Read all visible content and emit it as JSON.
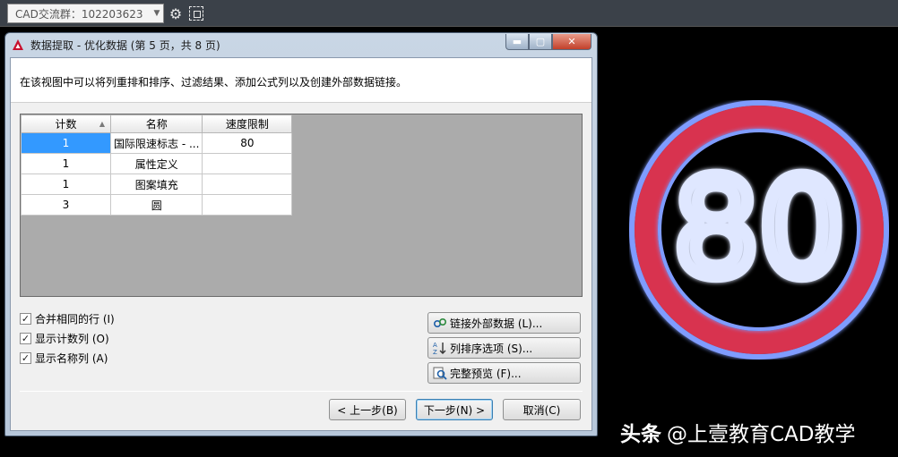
{
  "toolbar": {
    "combo_text": "CAD交流群：102203623",
    "combo_arrow": "▼",
    "gear_icon": "⚙"
  },
  "dialog": {
    "title": "数据提取 - 优化数据 (第 5 页，共 8 页)",
    "min_symbol": "▬",
    "max_symbol": "▢",
    "close_symbol": "✕",
    "intro": "在该视图中可以将列重排和排序、过滤结果、添加公式列以及创建外部数据链接。",
    "table": {
      "headers": [
        "计数",
        "名称",
        "速度限制"
      ],
      "sort_indicator": "▲",
      "rows": [
        [
          "1",
          "国际限速标志 - ...",
          "80"
        ],
        [
          "1",
          "属性定义",
          ""
        ],
        [
          "1",
          "图案填充",
          ""
        ],
        [
          "3",
          "圆",
          ""
        ]
      ]
    },
    "checkboxes": [
      {
        "label": "合并相同的行 (I)",
        "checked": true
      },
      {
        "label": "显示计数列 (O)",
        "checked": true
      },
      {
        "label": "显示名称列 (A)",
        "checked": true
      }
    ],
    "side_buttons": [
      {
        "label": "链接外部数据 (L)...",
        "icon": "link-icon"
      },
      {
        "label": "列排序选项 (S)...",
        "icon": "sort-az-icon"
      },
      {
        "label": "完整预览 (F)...",
        "icon": "preview-icon"
      }
    ],
    "nav": {
      "prev": "< 上一步(B)",
      "next": "下一步(N) >",
      "cancel": "取消(C)"
    }
  },
  "sign": {
    "speed": "80",
    "ring_color": "#d8334f",
    "glow_color": "#7f9cff",
    "digit_color": "#dfe7ff"
  },
  "watermark": {
    "brand": "头条",
    "text": "@上壹教育CAD教学"
  }
}
